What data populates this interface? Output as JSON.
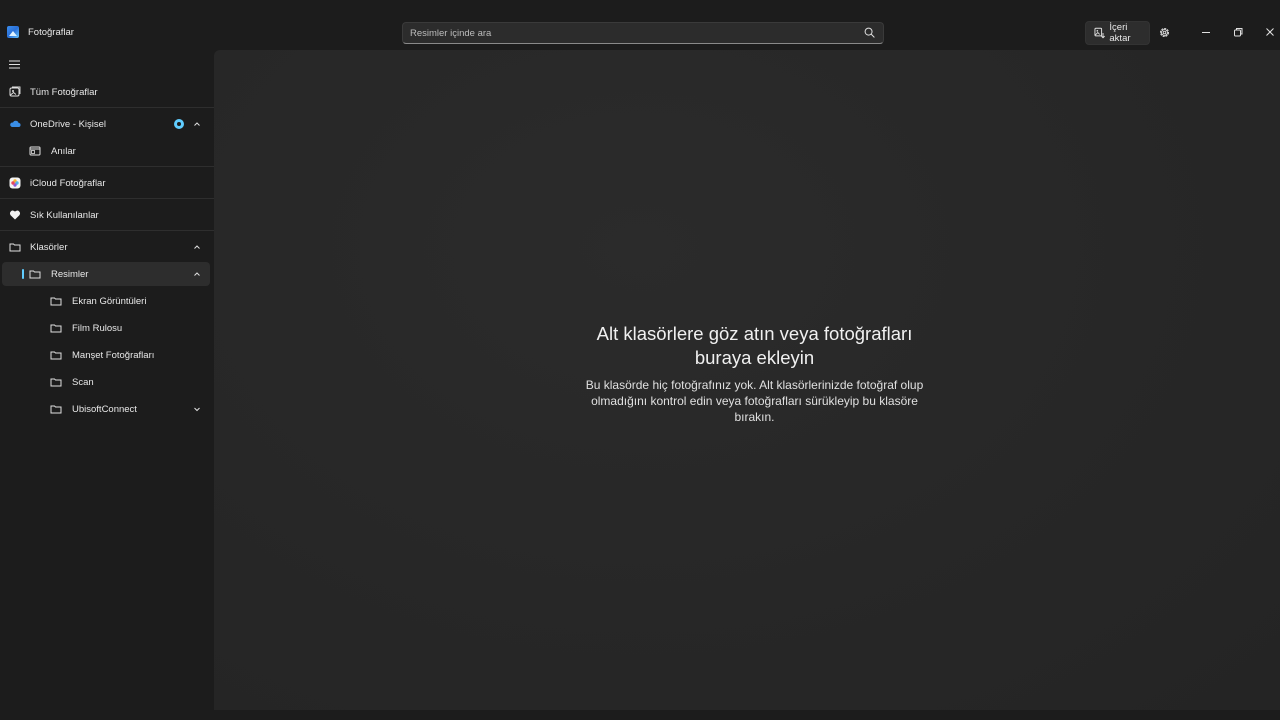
{
  "app": {
    "title": "Fotoğraflar"
  },
  "search": {
    "placeholder": "Resimler içinde ara"
  },
  "header": {
    "import_label": "İçeri aktar"
  },
  "sidebar": {
    "items": [
      {
        "label": "Tüm Fotoğraflar",
        "icon": "photos-icon"
      },
      {
        "label": "OneDrive - Kişisel",
        "icon": "onedrive-cloud-icon"
      },
      {
        "label": "Anılar",
        "icon": "memories-icon"
      },
      {
        "label": "iCloud Fotoğraflar",
        "icon": "icloud-photos-icon"
      },
      {
        "label": "Sık Kullanılanlar",
        "icon": "heart-icon"
      },
      {
        "label": "Klasörler",
        "icon": "folder-icon"
      },
      {
        "label": "Resimler",
        "icon": "folder-icon"
      },
      {
        "label": "Ekran Görüntüleri",
        "icon": "folder-icon"
      },
      {
        "label": "Film Rulosu",
        "icon": "folder-icon"
      },
      {
        "label": "Manşet Fotoğrafları",
        "icon": "folder-icon"
      },
      {
        "label": "Scan",
        "icon": "folder-icon"
      },
      {
        "label": "UbisoftConnect",
        "icon": "folder-icon"
      }
    ]
  },
  "main": {
    "empty_title": "Alt klasörlere göz atın veya fotoğrafları\nburaya ekleyin",
    "empty_description": "Bu klasörde hiç fotoğrafınız yok. Alt klasörlerinizde fotoğraf olup olmadığını kontrol edin veya fotoğrafları sürükleyip bu klasöre bırakın."
  },
  "colors": {
    "accent": "#60cdff",
    "background": "#1c1c1c",
    "content": "#272727"
  }
}
